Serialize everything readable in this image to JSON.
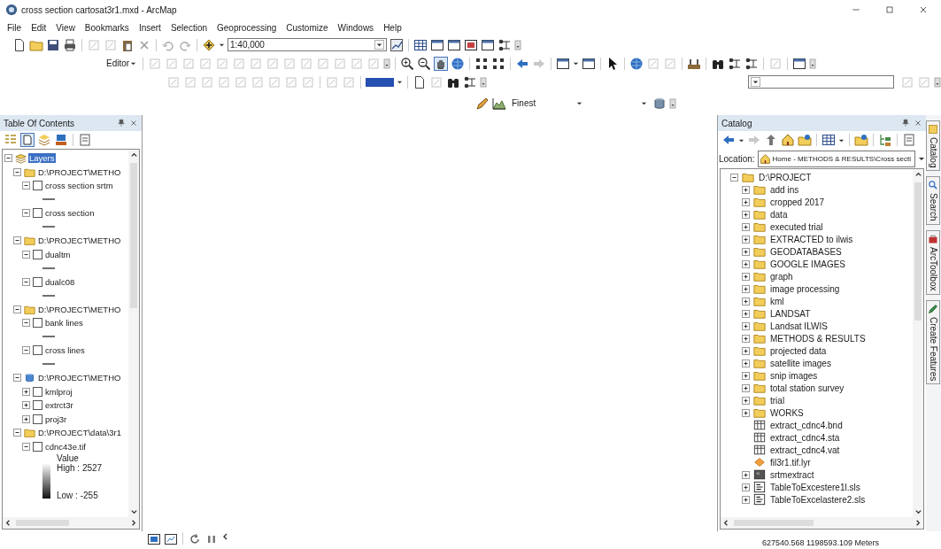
{
  "window": {
    "title": "cross section cartosat3r1.mxd - ArcMap"
  },
  "menu": [
    "File",
    "Edit",
    "View",
    "Bookmarks",
    "Insert",
    "Selection",
    "Geoprocessing",
    "Customize",
    "Windows",
    "Help"
  ],
  "toolbars": {
    "scale": "1:40,000",
    "editor": "Editor",
    "resolution": "Finest"
  },
  "toc": {
    "title": "Table Of Contents",
    "tree": [
      {
        "label": "Layers",
        "kind": "data_frame",
        "expanded": true,
        "selected": true,
        "children": [
          {
            "label": "D:\\PROJECT\\METHO",
            "kind": "folder",
            "expanded": true,
            "selected": false,
            "children": [
              {
                "label": "cross section srtm",
                "kind": "line_layer",
                "expanded": true,
                "checked": false,
                "selected": false
              },
              {
                "label": "cross section",
                "kind": "line_layer",
                "expanded": true,
                "checked": false,
                "selected": false
              }
            ]
          },
          {
            "label": "D:\\PROJECT\\METHO",
            "kind": "folder",
            "expanded": true,
            "selected": false,
            "children": [
              {
                "label": "dualtm",
                "kind": "line_layer",
                "expanded": true,
                "checked": false,
                "selected": false
              },
              {
                "label": "dualc08",
                "kind": "line_layer",
                "expanded": true,
                "checked": false,
                "selected": false
              }
            ]
          },
          {
            "label": "D:\\PROJECT\\METHO",
            "kind": "folder",
            "expanded": true,
            "selected": false,
            "children": [
              {
                "label": "bank lines",
                "kind": "line_layer",
                "expanded": true,
                "checked": false,
                "selected": false
              },
              {
                "label": "cross lines",
                "kind": "line_layer",
                "expanded": true,
                "checked": false,
                "selected": false
              }
            ]
          },
          {
            "label": "D:\\PROJECT\\METHO",
            "kind": "database",
            "expanded": true,
            "selected": false,
            "children": [
              {
                "label": "kmlproj",
                "kind": "line_layer",
                "expanded": false,
                "checked": false,
                "selected": false
              },
              {
                "label": "extrct3r",
                "kind": "line_layer",
                "expanded": false,
                "checked": false,
                "selected": false
              },
              {
                "label": "proj3r",
                "kind": "line_layer",
                "expanded": false,
                "checked": false,
                "selected": false
              }
            ]
          },
          {
            "label": "D:\\PROJECT\\data\\3r1",
            "kind": "folder",
            "expanded": true,
            "selected": false,
            "children": [
              {
                "label": "cdnc43e.tif",
                "kind": "raster_layer",
                "expanded": true,
                "checked": false,
                "selected": false,
                "legend": {
                  "title": "Value",
                  "high": "High : 2527",
                  "low": "Low : -255"
                }
              }
            ]
          }
        ]
      }
    ]
  },
  "catalog": {
    "title": "Catalog",
    "location_label": "Location:",
    "location": "Home - METHODS & RESULTS\\Cross secti",
    "tree": [
      {
        "label": "D:\\PROJECT",
        "kind": "folder",
        "expanded": true,
        "children": [
          {
            "label": "add ins",
            "kind": "folder",
            "expanded": false
          },
          {
            "label": "cropped 2017",
            "kind": "folder",
            "expanded": false
          },
          {
            "label": "data",
            "kind": "folder",
            "expanded": false
          },
          {
            "label": "executed trial",
            "kind": "folder",
            "expanded": false
          },
          {
            "label": "EXTRACTED to ilwis",
            "kind": "folder",
            "expanded": false
          },
          {
            "label": "GEODATABASES",
            "kind": "folder",
            "expanded": false
          },
          {
            "label": "GOOGLE IMAGES",
            "kind": "folder",
            "expanded": false
          },
          {
            "label": "graph",
            "kind": "folder",
            "expanded": false
          },
          {
            "label": "image processing",
            "kind": "folder",
            "expanded": false
          },
          {
            "label": "kml",
            "kind": "folder",
            "expanded": false
          },
          {
            "label": "LANDSAT",
            "kind": "folder",
            "expanded": false
          },
          {
            "label": "Landsat ILWIS",
            "kind": "folder",
            "expanded": false
          },
          {
            "label": "METHODS & RESULTS",
            "kind": "folder",
            "expanded": false
          },
          {
            "label": "projected data",
            "kind": "folder",
            "expanded": false
          },
          {
            "label": "satellite images",
            "kind": "folder",
            "expanded": false
          },
          {
            "label": "snip images",
            "kind": "folder",
            "expanded": false
          },
          {
            "label": "total station survey",
            "kind": "folder",
            "expanded": false
          },
          {
            "label": "trial",
            "kind": "folder",
            "expanded": false
          },
          {
            "label": "WORKS",
            "kind": "folder",
            "expanded": false
          },
          {
            "label": "extract_cdnc4.bnd",
            "kind": "table"
          },
          {
            "label": "extract_cdnc4.sta",
            "kind": "table"
          },
          {
            "label": "extract_cdnc4.vat",
            "kind": "table"
          },
          {
            "label": "fil3r1.tif.lyr",
            "kind": "layer_file"
          },
          {
            "label": "srtmextract",
            "kind": "raster",
            "expanded": false
          },
          {
            "label": "TableToExcestere1l.sls",
            "kind": "script",
            "expanded": false
          },
          {
            "label": "TableToExcelastere2.sls",
            "kind": "script",
            "expanded": false
          }
        ]
      }
    ]
  },
  "side_tabs": [
    "Catalog",
    "Search",
    "ArcToolbox",
    "Create Features"
  ],
  "status_bar": {
    "coordinates": "627540.568 1198593.109 Meters"
  }
}
